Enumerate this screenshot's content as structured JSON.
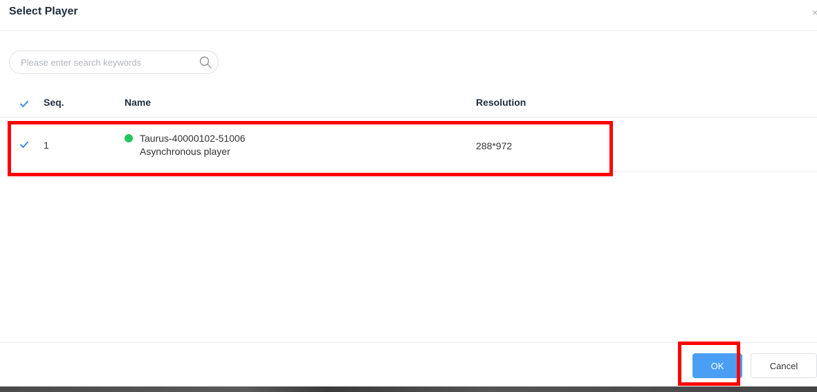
{
  "dialog": {
    "title": "Select Player",
    "close_glyph": "×"
  },
  "search": {
    "placeholder": "Please enter search keywords",
    "value": "",
    "icon": "search-icon"
  },
  "table": {
    "columns": {
      "seq": "Seq.",
      "name": "Name",
      "resolution": "Resolution"
    },
    "header_checked": true,
    "rows": [
      {
        "checked": true,
        "seq": "1",
        "name": "Taurus-40000102-51006",
        "type": "Asynchronous player",
        "status": "online",
        "status_color": "#22c55e",
        "resolution": "288*972"
      }
    ]
  },
  "footer": {
    "ok_label": "OK",
    "cancel_label": "Cancel"
  },
  "colors": {
    "accent": "#4a9ff5",
    "highlight": "#ff0000",
    "checkbox": "#3b8beb"
  }
}
